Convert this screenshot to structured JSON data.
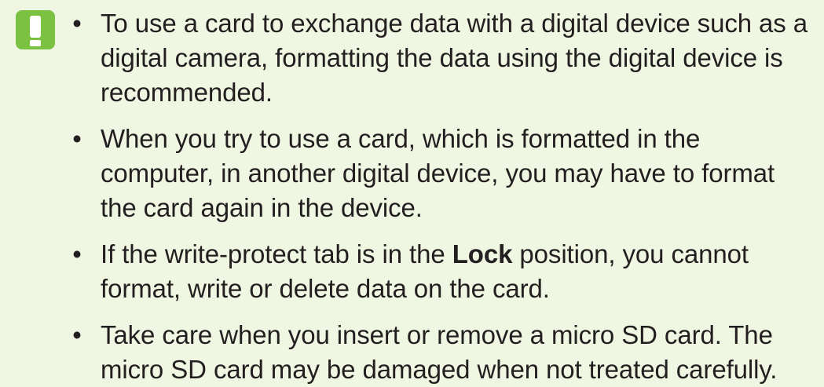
{
  "notice": {
    "icon": "exclamation-icon",
    "icon_color": "#7cc242"
  },
  "notes": [
    {
      "text": "To use a card to exchange data with a digital device such as a digital camera, formatting the data using the digital device is recommended."
    },
    {
      "text": "When you try to use a card, which is formatted in the computer, in another digital device, you may have to format the card again in the device."
    },
    {
      "before": "If the write-protect tab is in the ",
      "bold": "Lock",
      "after": " position, you cannot format, write or delete data on the card."
    },
    {
      "text": "Take care when you insert or remove a micro SD card. The micro SD card may be damaged when not treated carefully."
    }
  ],
  "bullet_glyph": "•"
}
